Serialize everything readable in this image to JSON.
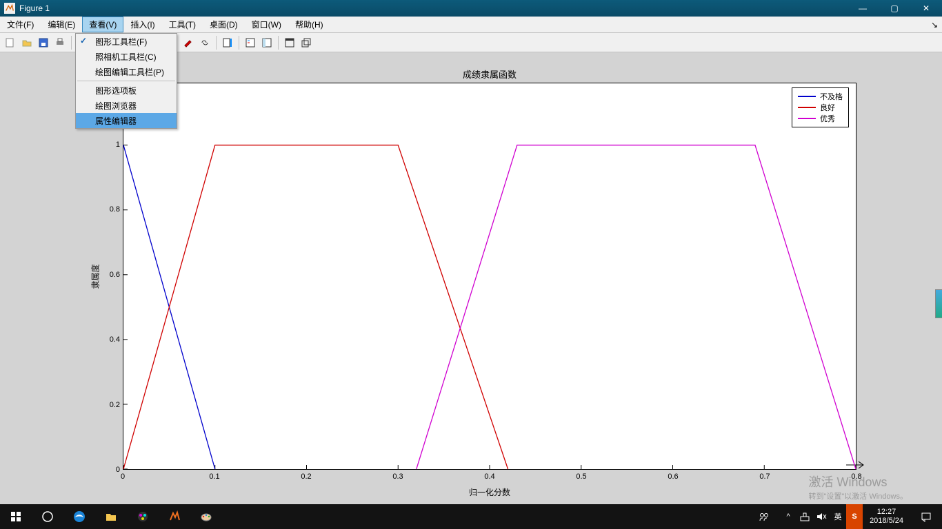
{
  "window": {
    "title": "Figure 1"
  },
  "winbtns": {
    "min": "—",
    "max": "▢",
    "close": "✕"
  },
  "menubar": {
    "items": [
      "文件(F)",
      "编辑(E)",
      "查看(V)",
      "插入(I)",
      "工具(T)",
      "桌面(D)",
      "窗口(W)",
      "帮助(H)"
    ],
    "active_index": 2
  },
  "dropdown": {
    "items": [
      {
        "label": "图形工具栏(F)",
        "checked": true
      },
      {
        "label": "照相机工具栏(C)"
      },
      {
        "label": "绘图编辑工具栏(P)"
      },
      {
        "sep": true
      },
      {
        "label": "图形选项板"
      },
      {
        "label": "绘图浏览器"
      },
      {
        "label": "属性编辑器",
        "highlight": true
      }
    ]
  },
  "chart_data": {
    "type": "line",
    "title": "成绩隶属函数",
    "xlabel": "归一化分数",
    "ylabel": "隶属度",
    "xlim": [
      0,
      0.8
    ],
    "ylim": [
      0,
      1
    ],
    "xticks": [
      0,
      0.1,
      0.2,
      0.3,
      0.4,
      0.5,
      0.6,
      0.7,
      0.8
    ],
    "yticks": [
      0,
      0.2,
      0.4,
      0.6,
      0.8,
      1
    ],
    "series": [
      {
        "name": "不及格",
        "color": "#0000cc",
        "x": [
          0,
          0.1
        ],
        "y": [
          1,
          0
        ]
      },
      {
        "name": "良好",
        "color": "#d00000",
        "x": [
          0,
          0.1,
          0.3,
          0.42
        ],
        "y": [
          0,
          1,
          1,
          0
        ]
      },
      {
        "name": "优秀",
        "color": "#d000d0",
        "x": [
          0.32,
          0.43,
          0.69,
          0.8
        ],
        "y": [
          0,
          1,
          1,
          0
        ]
      }
    ]
  },
  "watermark": {
    "line1": "激活 Windows",
    "line2": "转到\"设置\"以激活 Windows。"
  },
  "taskbar": {
    "time": "12:27",
    "date": "2018/5/24",
    "ime": "英",
    "sogou": "S"
  }
}
